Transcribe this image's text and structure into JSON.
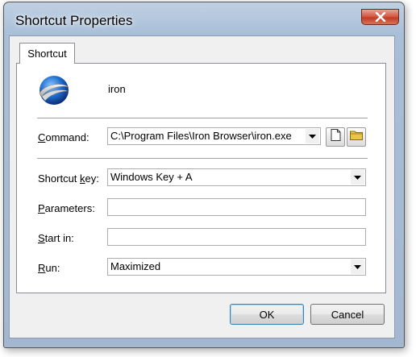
{
  "window": {
    "title": "Shortcut Properties"
  },
  "tabs": [
    {
      "label": "Shortcut"
    }
  ],
  "app": {
    "name": "iron",
    "icon": "iron-browser-logo-icon"
  },
  "fields": {
    "command": {
      "label_mnemonic": "C",
      "label_rest": "ommand:",
      "value": "C:\\Program Files\\Iron Browser\\iron.exe"
    },
    "shortcut_key": {
      "label_before": "Shortcut ",
      "label_mnemonic": "k",
      "label_after": "ey:",
      "value": "Windows Key + A"
    },
    "parameters": {
      "label_mnemonic": "P",
      "label_rest": "arameters:",
      "value": ""
    },
    "start_in": {
      "label_mnemonic": "S",
      "label_rest": "tart in:",
      "value": ""
    },
    "run": {
      "label_mnemonic": "R",
      "label_rest": "un:",
      "value": "Maximized"
    }
  },
  "buttons": {
    "ok": "OK",
    "cancel": "Cancel"
  },
  "icons": {
    "close": "close-icon",
    "new_file": "new-file-icon",
    "folder": "folder-icon",
    "dropdown": "chevron-down-icon"
  },
  "colors": {
    "title_bar": "#a9bfd8",
    "close_button": "#c8442c",
    "default_button_border": "#3c7fb1"
  }
}
